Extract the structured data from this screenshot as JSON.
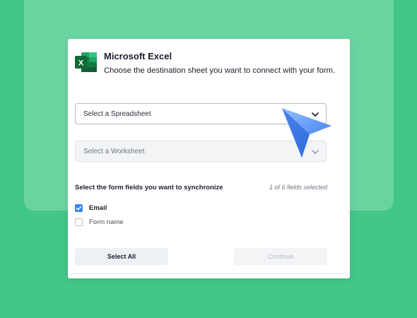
{
  "header": {
    "title": "Microsoft Excel",
    "subtitle": "Choose the destination sheet you want to connect with your form.",
    "logo_icon": "excel-logo-icon"
  },
  "selects": {
    "spreadsheet_placeholder": "Select a Spreadsheet",
    "worksheet_placeholder": "Select a Worksheet",
    "chevron_icon": "chevron-down-icon"
  },
  "fields": {
    "section_label": "Select the form fields you want to synchronize",
    "count_text": "1 of 6 fields selected",
    "items": [
      {
        "label": "Email",
        "checked": true
      },
      {
        "label": "Form name",
        "checked": false
      }
    ]
  },
  "actions": {
    "select_all_label": "Select All",
    "continue_label": "Continue"
  },
  "colors": {
    "background": "#42c68a",
    "accent_blue": "#3b82f6",
    "excel_green": "#107c41"
  }
}
